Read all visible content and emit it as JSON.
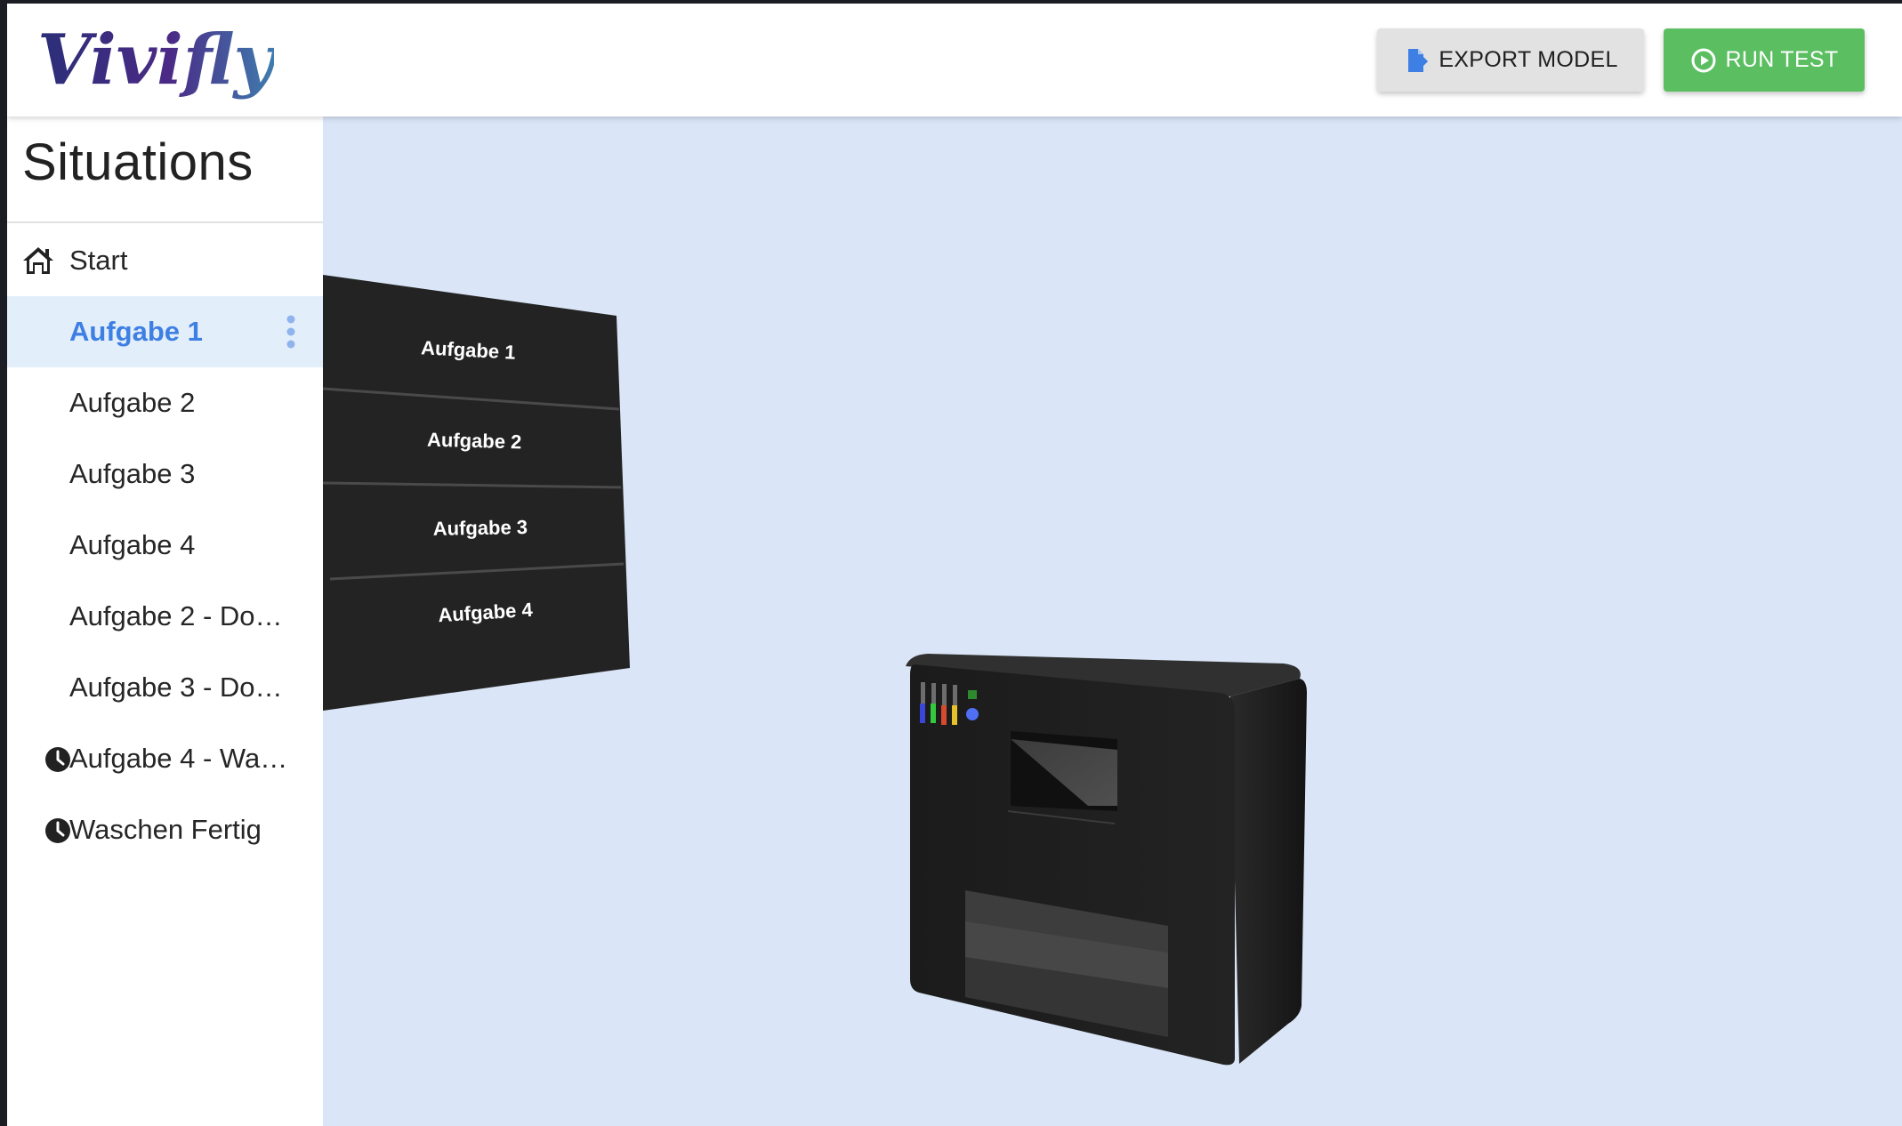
{
  "app": {
    "logo_text": "Vivifly"
  },
  "header": {
    "export_label": "EXPORT MODEL",
    "run_label": "RUN TEST"
  },
  "sidebar": {
    "title": "Situations",
    "items": [
      {
        "label": "Start",
        "icon": "home-icon",
        "active": false
      },
      {
        "label": "Aufgabe 1",
        "active": true
      },
      {
        "label": "Aufgabe 2",
        "active": false
      },
      {
        "label": "Aufgabe 3",
        "active": false
      },
      {
        "label": "Aufgabe 4",
        "active": false
      },
      {
        "label": "Aufgabe 2 - Do…",
        "active": false
      },
      {
        "label": "Aufgabe 3 - Do…",
        "active": false
      },
      {
        "label": "Aufgabe 4 - Wa…",
        "icon": "clock-icon",
        "active": false
      },
      {
        "label": "Waschen Fertig",
        "icon": "clock-icon",
        "active": false
      }
    ]
  },
  "scene": {
    "panel_buttons": [
      "Aufgabe 1",
      "Aufgabe 2",
      "Aufgabe 3",
      "Aufgabe 4"
    ]
  },
  "colors": {
    "accent_blue": "#3e7fe3",
    "run_green": "#5bbf62",
    "viewport_bg": "#dae6f7"
  }
}
